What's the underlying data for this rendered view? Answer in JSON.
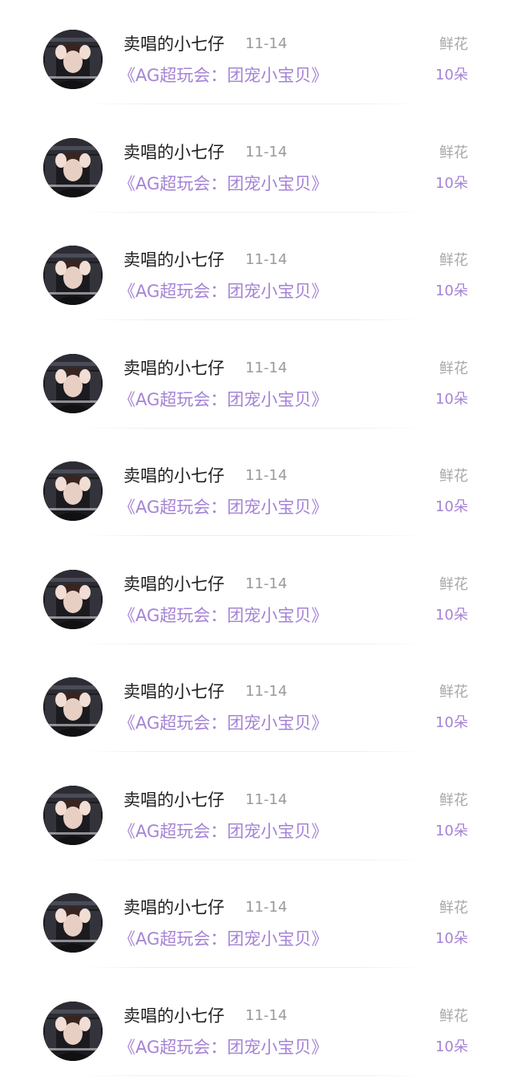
{
  "gift_list": {
    "items": [
      {
        "user_name": "卖唱的小七仔",
        "date": "11-14",
        "work_title": "《AG超玩会：团宠小宝贝》",
        "gift_type": "鲜花",
        "gift_count": "10朵",
        "avatar_icon": "user-avatar"
      },
      {
        "user_name": "卖唱的小七仔",
        "date": "11-14",
        "work_title": "《AG超玩会：团宠小宝贝》",
        "gift_type": "鲜花",
        "gift_count": "10朵",
        "avatar_icon": "user-avatar"
      },
      {
        "user_name": "卖唱的小七仔",
        "date": "11-14",
        "work_title": "《AG超玩会：团宠小宝贝》",
        "gift_type": "鲜花",
        "gift_count": "10朵",
        "avatar_icon": "user-avatar"
      },
      {
        "user_name": "卖唱的小七仔",
        "date": "11-14",
        "work_title": "《AG超玩会：团宠小宝贝》",
        "gift_type": "鲜花",
        "gift_count": "10朵",
        "avatar_icon": "user-avatar"
      },
      {
        "user_name": "卖唱的小七仔",
        "date": "11-14",
        "work_title": "《AG超玩会：团宠小宝贝》",
        "gift_type": "鲜花",
        "gift_count": "10朵",
        "avatar_icon": "user-avatar"
      },
      {
        "user_name": "卖唱的小七仔",
        "date": "11-14",
        "work_title": "《AG超玩会：团宠小宝贝》",
        "gift_type": "鲜花",
        "gift_count": "10朵",
        "avatar_icon": "user-avatar"
      },
      {
        "user_name": "卖唱的小七仔",
        "date": "11-14",
        "work_title": "《AG超玩会：团宠小宝贝》",
        "gift_type": "鲜花",
        "gift_count": "10朵",
        "avatar_icon": "user-avatar"
      },
      {
        "user_name": "卖唱的小七仔",
        "date": "11-14",
        "work_title": "《AG超玩会：团宠小宝贝》",
        "gift_type": "鲜花",
        "gift_count": "10朵",
        "avatar_icon": "user-avatar"
      },
      {
        "user_name": "卖唱的小七仔",
        "date": "11-14",
        "work_title": "《AG超玩会：团宠小宝贝》",
        "gift_type": "鲜花",
        "gift_count": "10朵",
        "avatar_icon": "user-avatar"
      },
      {
        "user_name": "卖唱的小七仔",
        "date": "11-14",
        "work_title": "《AG超玩会：团宠小宝贝》",
        "gift_type": "鲜花",
        "gift_count": "10朵",
        "avatar_icon": "user-avatar"
      }
    ]
  },
  "colors": {
    "name_text": "#1f1f1f",
    "date_text": "#9a9a9a",
    "accent_purple": "#a583d6",
    "gift_type_text": "#a8a8a8",
    "background": "#ffffff"
  }
}
